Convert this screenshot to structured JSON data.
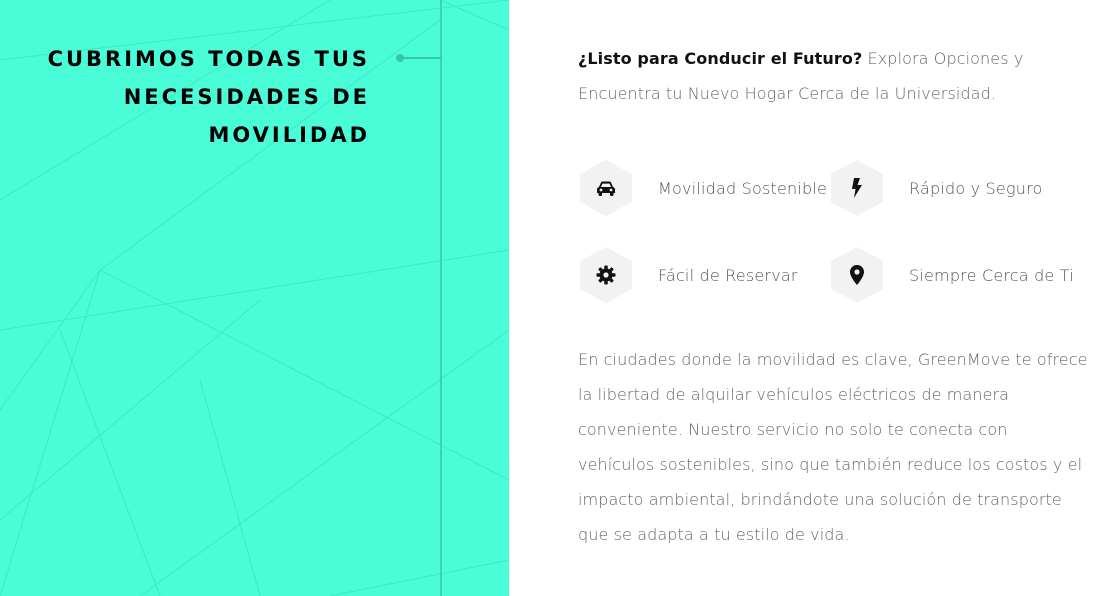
{
  "colors": {
    "left_background": "#48fdd8",
    "accent_line": "#3cd2b4",
    "heading_text": "#000000",
    "body_text": "#666666",
    "hex_background": "#f2f2f2"
  },
  "left": {
    "heading_lines": [
      "CUBRIMOS TODAS TUS",
      "NECESIDADES DE",
      "MOVILIDAD"
    ]
  },
  "intro": {
    "bold": "¿Listo para Conducir el Futuro?",
    "text": " Explora Opciones y Encuentra tu Nuevo Hogar Cerca de la Universidad."
  },
  "features": [
    {
      "icon": "car-icon",
      "label": "Movilidad Sostenible"
    },
    {
      "icon": "bolt-icon",
      "label": "Rápido y Seguro"
    },
    {
      "icon": "gear-icon",
      "label": "Fácil de Reservar"
    },
    {
      "icon": "map-pin-icon",
      "label": "Siempre Cerca de Ti"
    }
  ],
  "description": "En ciudades donde la movilidad es clave, GreenMove te ofrece la libertad de alquilar vehículos eléctricos de manera conveniente. Nuestro servicio no solo te conecta con vehículos sostenibles, sino que también reduce los costos y el impacto ambiental, brindándote una solución de transporte que se adapta a tu estilo de vida."
}
